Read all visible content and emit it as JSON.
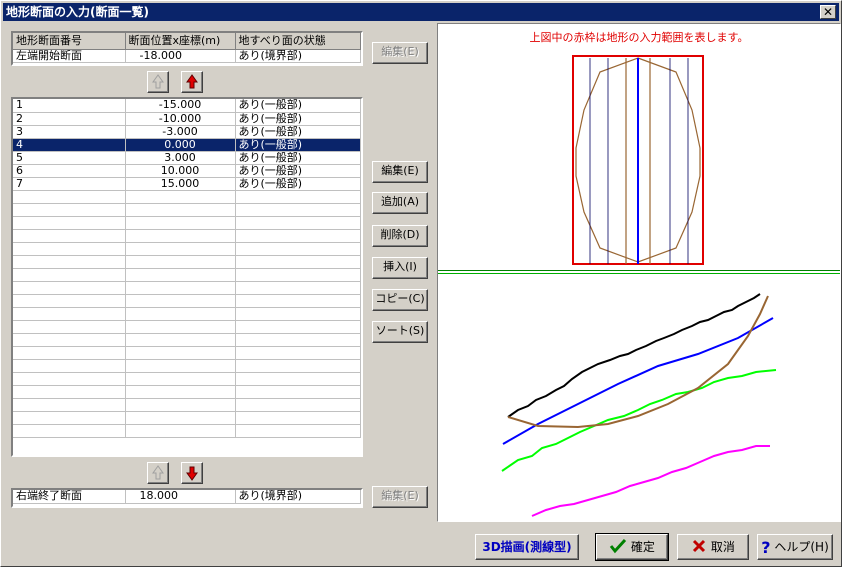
{
  "window": {
    "title": "地形断面の入力(断面一覧)",
    "close_glyph": "✕"
  },
  "top_grid": {
    "headers": [
      "地形断面番号",
      "断面位置x座標(m)",
      "地すべり面の状態"
    ],
    "row": [
      "左端開始断面",
      "-18.000",
      "あり(境界部)"
    ]
  },
  "main_grid": {
    "rows": [
      [
        "1",
        "-15.000",
        "あり(一般部)"
      ],
      [
        "2",
        "-10.000",
        "あり(一般部)"
      ],
      [
        "3",
        "-3.000",
        "あり(一般部)"
      ],
      [
        "4",
        "0.000",
        "あり(一般部)"
      ],
      [
        "5",
        "3.000",
        "あり(一般部)"
      ],
      [
        "6",
        "10.000",
        "あり(一般部)"
      ],
      [
        "7",
        "15.000",
        "あり(一般部)"
      ]
    ],
    "selected_row": "4"
  },
  "bottom_grid": {
    "row": [
      "右端終了断面",
      "18.000",
      "あり(境界部)"
    ]
  },
  "buttons": {
    "edit_top": "編集(E)",
    "edit": "編集(E)",
    "add": "追加(A)",
    "delete": "削除(D)",
    "insert": "挿入(I)",
    "copy": "コピー(C)",
    "sort": "ソート(S)",
    "edit_bottom": "編集(E)"
  },
  "preview": {
    "note": "上図中の赤枠は地形の入力範囲を表します。"
  },
  "footer": {
    "draw3d": "3D描画(測線型)",
    "ok": "確定",
    "cancel": "取消",
    "help": "ヘルプ(H)"
  },
  "colors": {
    "titlebar": "#0a246a",
    "range_frame": "#e00000",
    "ground_line": "#000000",
    "blue_line": "#0000ff",
    "green_line": "#00ff00",
    "magenta_line": "#ff00ff",
    "slip_surface": "#996633"
  },
  "icons": {
    "up_arrow": "arrow-up-icon",
    "down_arrow": "arrow-down-icon",
    "ok": "checkmark-icon",
    "cancel": "x-icon",
    "help": "question-icon"
  }
}
